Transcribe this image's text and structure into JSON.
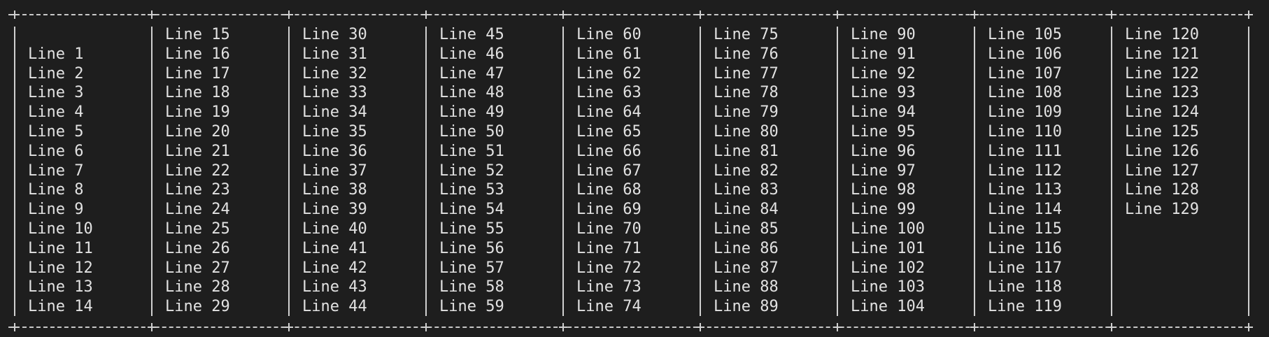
{
  "terminal": {
    "columns": [
      {
        "lines": [
          "",
          "Line 1",
          "Line 2",
          "Line 3",
          "Line 4",
          "Line 5",
          "Line 6",
          "Line 7",
          "Line 8",
          "Line 9",
          "Line 10",
          "Line 11",
          "Line 12",
          "Line 13",
          "Line 14"
        ]
      },
      {
        "lines": [
          "Line 15",
          "Line 16",
          "Line 17",
          "Line 18",
          "Line 19",
          "Line 20",
          "Line 21",
          "Line 22",
          "Line 23",
          "Line 24",
          "Line 25",
          "Line 26",
          "Line 27",
          "Line 28",
          "Line 29"
        ]
      },
      {
        "lines": [
          "Line 30",
          "Line 31",
          "Line 32",
          "Line 33",
          "Line 34",
          "Line 35",
          "Line 36",
          "Line 37",
          "Line 38",
          "Line 39",
          "Line 40",
          "Line 41",
          "Line 42",
          "Line 43",
          "Line 44"
        ]
      },
      {
        "lines": [
          "Line 45",
          "Line 46",
          "Line 47",
          "Line 48",
          "Line 49",
          "Line 50",
          "Line 51",
          "Line 52",
          "Line 53",
          "Line 54",
          "Line 55",
          "Line 56",
          "Line 57",
          "Line 58",
          "Line 59"
        ]
      },
      {
        "lines": [
          "Line 60",
          "Line 61",
          "Line 62",
          "Line 63",
          "Line 64",
          "Line 65",
          "Line 66",
          "Line 67",
          "Line 68",
          "Line 69",
          "Line 70",
          "Line 71",
          "Line 72",
          "Line 73",
          "Line 74"
        ]
      },
      {
        "lines": [
          "Line 75",
          "Line 76",
          "Line 77",
          "Line 78",
          "Line 79",
          "Line 80",
          "Line 81",
          "Line 82",
          "Line 83",
          "Line 84",
          "Line 85",
          "Line 86",
          "Line 87",
          "Line 88",
          "Line 89"
        ]
      },
      {
        "lines": [
          "Line 90",
          "Line 91",
          "Line 92",
          "Line 93",
          "Line 94",
          "Line 95",
          "Line 96",
          "Line 97",
          "Line 98",
          "Line 99",
          "Line 100",
          "Line 101",
          "Line 102",
          "Line 103",
          "Line 104"
        ]
      },
      {
        "lines": [
          "Line 105",
          "Line 106",
          "Line 107",
          "Line 108",
          "Line 109",
          "Line 110",
          "Line 111",
          "Line 112",
          "Line 113",
          "Line 114",
          "Line 115",
          "Line 116",
          "Line 117",
          "Line 118",
          "Line 119"
        ]
      },
      {
        "lines": [
          "Line 120",
          "Line 121",
          "Line 122",
          "Line 123",
          "Line 124",
          "Line 125",
          "Line 126",
          "Line 127",
          "Line 128",
          "Line 129"
        ]
      }
    ]
  }
}
